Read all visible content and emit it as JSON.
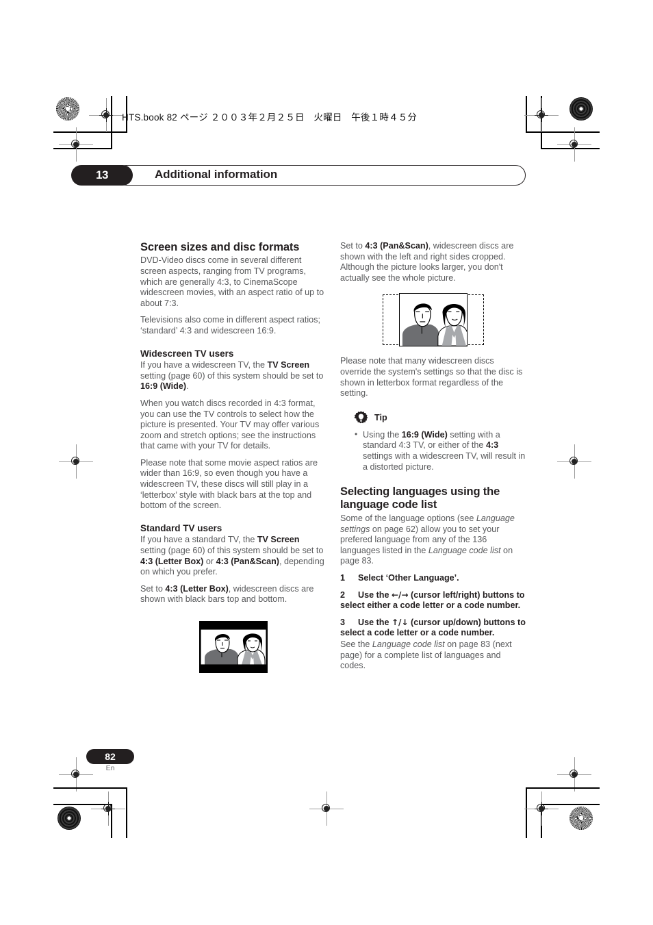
{
  "print_header": {
    "book_line": "HTS.book  82 ページ  ２００３年２月２５日　火曜日　午後１時４５分"
  },
  "chapter": {
    "number": "13",
    "title": "Additional information"
  },
  "left_column": {
    "heading": "Screen sizes and disc formats",
    "intro_p1": "DVD-Video discs come in several different screen aspects, ranging from TV programs, which are generally 4:3, to CinemaScope widescreen movies, with an aspect ratio of up to about 7:3.",
    "intro_p2": "Televisions also come in different aspect ratios; ‘standard’ 4:3 and widescreen 16:9.",
    "widescreen_heading": "Widescreen TV users",
    "widescreen_p1_a": "If you have a widescreen TV, the ",
    "widescreen_p1_b": "TV Screen",
    "widescreen_p1_c": " setting (page 60) of this system should be set to ",
    "widescreen_p1_d": "16:9 (Wide)",
    "widescreen_p1_e": ".",
    "widescreen_p2": "When you watch discs recorded in 4:3 format, you can use the TV controls to select how the picture is presented. Your TV may offer various zoom and stretch options; see the instructions that came with your TV for details.",
    "widescreen_p3": "Please note that some movie aspect ratios are wider than 16:9, so even though you have a widescreen TV, these discs will still play in a ‘letterbox’ style with black bars at the top and bottom of the screen.",
    "standard_heading": "Standard TV users",
    "standard_p1_a": "If you have a standard TV, the ",
    "standard_p1_b": "TV Screen",
    "standard_p1_c": " setting (page 60) of this system should be set to ",
    "standard_p1_d": "4:3 (Letter Box)",
    "standard_p1_e": " or ",
    "standard_p1_f": "4:3 (Pan&Scan)",
    "standard_p1_g": ", depending on which you prefer.",
    "standard_p2_a": "Set to ",
    "standard_p2_b": "4:3 (Letter Box)",
    "standard_p2_c": ", widescreen discs are shown with black bars top and bottom.",
    "letterbox_image_caption": "letterbox-tv-picture"
  },
  "right_column": {
    "panscan_p1_a": "Set to ",
    "panscan_p1_b": "4:3 (Pan&Scan)",
    "panscan_p1_c": ", widescreen discs are shown with the left and right sides cropped. Although the picture looks larger, you don't actually see the whole picture.",
    "panscan_image_caption": "pan-and-scan-tv-picture",
    "panscan_p2": "Please note that many widescreen discs override the system's settings so that the disc is shown in letterbox format regardless of the setting.",
    "tip_label": "Tip",
    "tip_icon": "gear-lightbulb-icon",
    "tip_bullet_a": "Using the ",
    "tip_bullet_b": "16:9 (Wide)",
    "tip_bullet_c": " setting with a standard 4:3 TV, or either of the ",
    "tip_bullet_d": "4:3",
    "tip_bullet_e": " settings with a widescreen TV, will result in a distorted picture.",
    "lang_heading": "Selecting languages using the language code list",
    "lang_p1_a": "Some of the language options (see ",
    "lang_p1_b": "Language settings",
    "lang_p1_c": " on page 62) allow you to set your prefered language from any of the 136 languages listed in the ",
    "lang_p1_d": "Language code list",
    "lang_p1_e": " on page 83.",
    "steps": [
      {
        "num": "1",
        "text": "Select ‘Other Language’."
      },
      {
        "num": "2",
        "text_a": "Use the ",
        "arrows": "←/→",
        "text_b": " (cursor left/right) buttons to select either a code letter or a code number."
      },
      {
        "num": "3",
        "text_a": "Use the ",
        "arrows": "↑/↓",
        "text_b": " (cursor up/down) buttons to select a code letter or a code number."
      }
    ],
    "after_steps_a": "See the ",
    "after_steps_b": "Language code list",
    "after_steps_c": " on page 83 (next page) for a complete list of languages and codes."
  },
  "footer": {
    "page_number": "82",
    "language_code": "En"
  },
  "colors": {
    "ink_black": "#231f20",
    "body_gray": "#58595b",
    "paper": "#ffffff"
  }
}
